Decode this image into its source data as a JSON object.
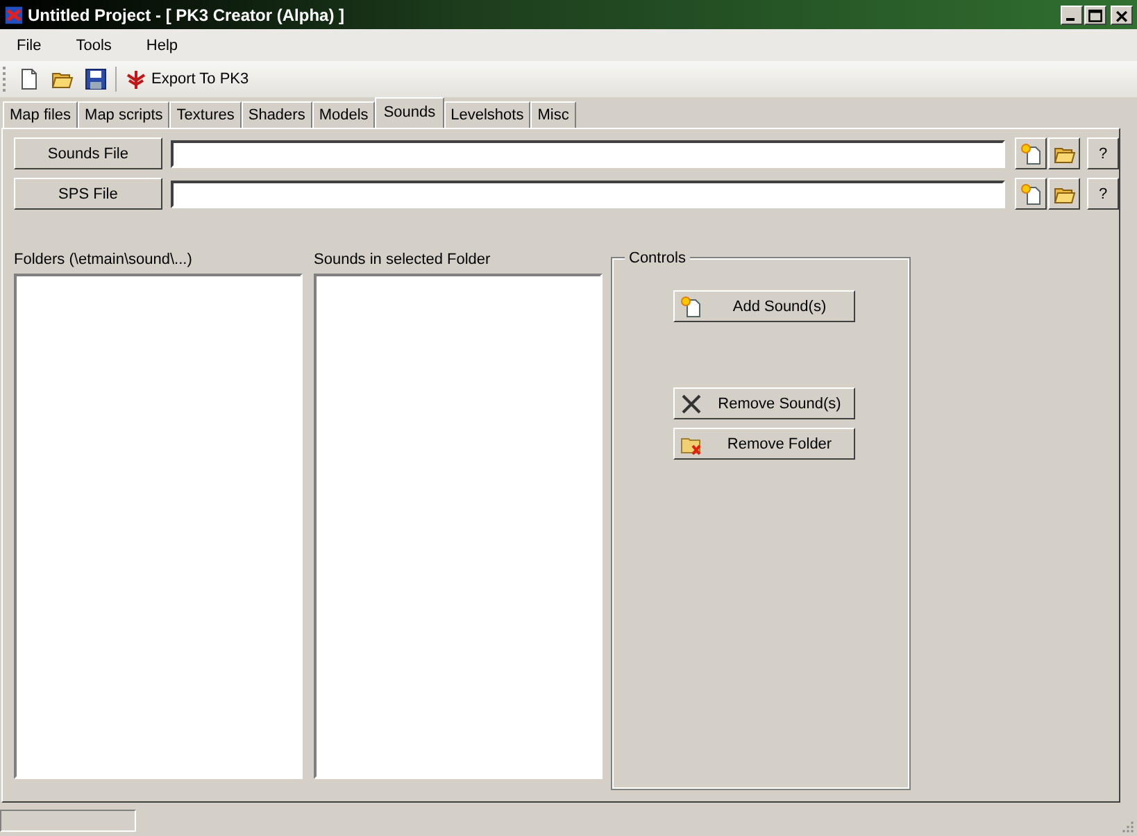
{
  "window": {
    "title": "Untitled Project - [ PK3 Creator (Alpha) ]"
  },
  "menu": [
    "File",
    "Tools",
    "Help"
  ],
  "toolbar": [
    {
      "kind": "new"
    },
    {
      "kind": "open"
    },
    {
      "kind": "save"
    },
    {
      "kind": "export",
      "label": "Export To PK3"
    }
  ],
  "tabs": [
    {
      "label": "Map files",
      "selected": false
    },
    {
      "label": "Map scripts",
      "selected": false
    },
    {
      "label": "Textures",
      "selected": false
    },
    {
      "label": "Shaders",
      "selected": false
    },
    {
      "label": "Models",
      "selected": false
    },
    {
      "label": "Sounds",
      "selected": true
    },
    {
      "label": "Levelshots",
      "selected": false
    },
    {
      "label": "Misc",
      "selected": false
    }
  ],
  "files": [
    {
      "button": "Sounds File",
      "help": "?"
    },
    {
      "button": "SPS File",
      "help": "?"
    }
  ],
  "lists": [
    {
      "label": "Folders (\\etmain\\sound\\...)"
    },
    {
      "label": "Sounds in selected Folder"
    }
  ],
  "controls": {
    "title": "Controls",
    "buttons": [
      {
        "label": "Add Sound(s)",
        "kind": "add"
      },
      {
        "label": "Remove Sound(s)",
        "kind": "remove"
      },
      {
        "label": "Remove Folder",
        "kind": "remove-folder"
      }
    ]
  }
}
